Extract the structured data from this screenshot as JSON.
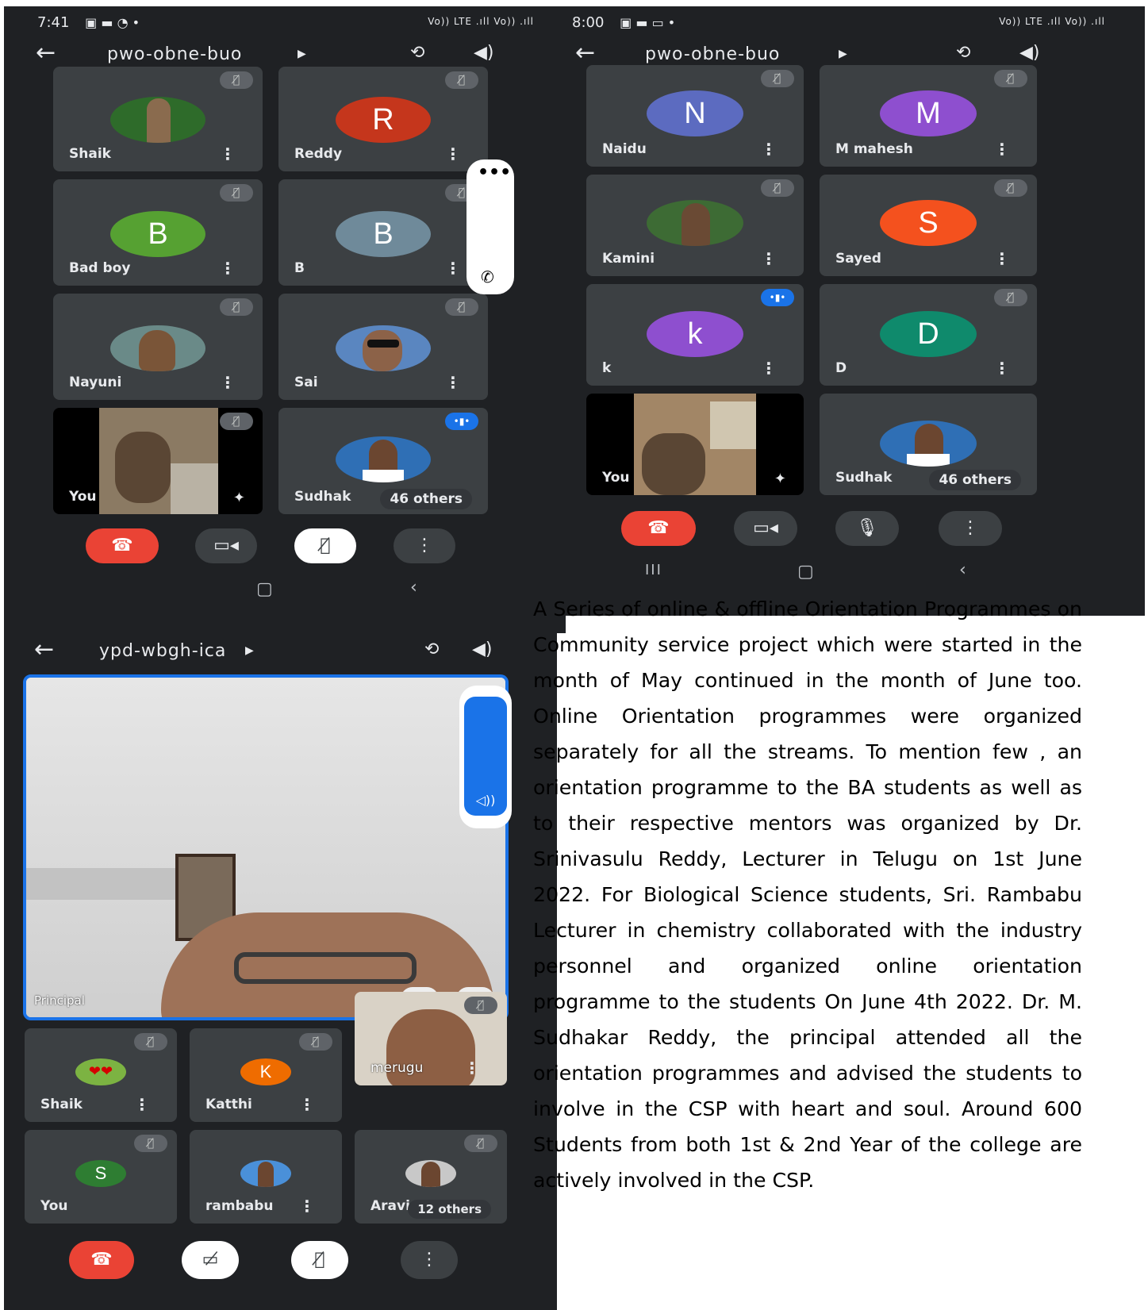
{
  "screen1": {
    "time": "7:41",
    "signal": "Vo)) LTE .ıll Vo)) .ıll",
    "meeting_code": "pwo-obne-buo",
    "tiles": [
      {
        "name": "Shaik"
      },
      {
        "name": "Reddy",
        "initial": "R",
        "color": "#c5361c"
      },
      {
        "name": "Bad boy",
        "initial": "B",
        "color": "#56a132"
      },
      {
        "name": "B",
        "initial": "B",
        "color": "#6f8a9a"
      },
      {
        "name": "Nayuni"
      },
      {
        "name": "Sai"
      },
      {
        "name": "You"
      },
      {
        "name": "Sudhak",
        "others": "46 others"
      }
    ]
  },
  "screen2": {
    "time": "8:00",
    "signal": "Vo)) LTE .ıll Vo)) .ıll",
    "meeting_code": "pwo-obne-buo",
    "tiles": [
      {
        "name": "Naidu",
        "initial": "N",
        "color": "#5c6bc0"
      },
      {
        "name": "M mahesh",
        "initial": "M",
        "color": "#8e4fcf"
      },
      {
        "name": "Kamini"
      },
      {
        "name": "Sayed",
        "initial": "S",
        "color": "#f4511e"
      },
      {
        "name": "k",
        "initial": "k",
        "color": "#8e4fcf"
      },
      {
        "name": "D",
        "initial": "D",
        "color": "#0f8a6c"
      },
      {
        "name": "You"
      },
      {
        "name": "Sudhak",
        "others": "46 others"
      }
    ]
  },
  "screen3": {
    "meeting_code": "ypd-wbgh-ica",
    "main_speaker": "Principal",
    "tiles": [
      {
        "name": "Shaik"
      },
      {
        "name": "Katthi",
        "initial": "K",
        "color": "#ef6c00"
      },
      {
        "name": "merugu"
      },
      {
        "name": "You",
        "initial": "S",
        "color": "#2e7d32"
      },
      {
        "name": "rambabu"
      },
      {
        "name": "Aravi",
        "others": "12 others"
      }
    ]
  },
  "article": {
    "text": "A Series of online & offline  Orientation Programmes on Community service project which  were started in the month of May continued in the month of June too. Online  Orientation  programmes  were  organized separately for all the streams. To mention few , an orientation programme to the BA students as well as to their respective mentors was organized by Dr. Srinivasulu Reddy, Lecturer in Telugu on 1st June 2022.  For Biological Science students, Sri. Rambabu Lecturer in chemistry collaborated with the industry personnel  and  organized  online  orientation programme to the students On June 4th 2022. Dr. M. Sudhakar Reddy, the principal attended all the orientation programmes and advised the students to involve in the CSP with heart and soul. Around 600 Students from both 1st & 2nd Year of the college are actively involved in the CSP."
  }
}
